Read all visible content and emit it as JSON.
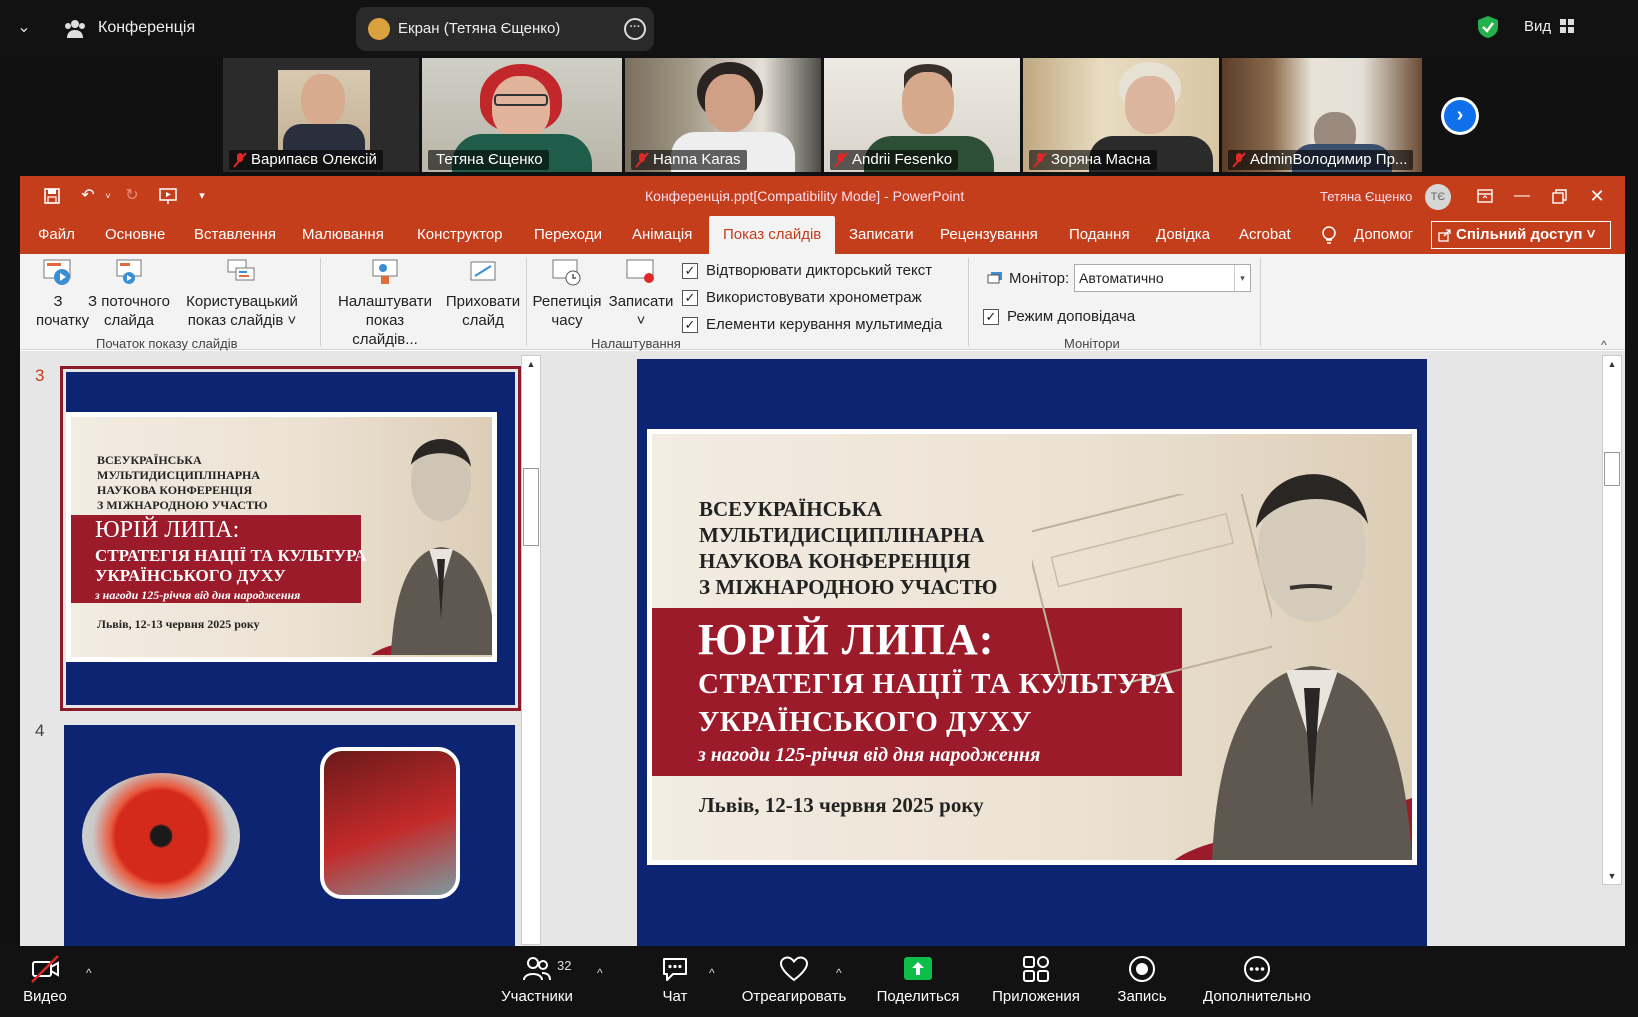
{
  "zoom_top": {
    "meeting_label": "Конференція",
    "screen_share_label": "Екран (Тетяна Єщенко)",
    "view_label": "Вид"
  },
  "participants": [
    {
      "name": "Варипаєв Олексій",
      "active": false,
      "muted": true
    },
    {
      "name": "Тетяна Єщенко",
      "active": true,
      "muted": false
    },
    {
      "name": "Hanna Karas",
      "active": false,
      "muted": true
    },
    {
      "name": "Andrii Fesenko",
      "active": false,
      "muted": true
    },
    {
      "name": "Зоряна Масна",
      "active": false,
      "muted": true
    },
    {
      "name": "AdminВолодимир Пр...",
      "active": false,
      "muted": true
    }
  ],
  "ppt": {
    "title": "Конференція.ppt[Compatibility Mode]  -  PowerPoint",
    "user": "Тетяна Єщенко",
    "user_initials": "ТЄ",
    "tabs": [
      "Файл",
      "Основне",
      "Вставлення",
      "Малювання",
      "Конструктор",
      "Переходи",
      "Анімація",
      "Показ слайдів",
      "Записати",
      "Рецензування",
      "Подання",
      "Довідка",
      "Acrobat"
    ],
    "selected_tab": "Показ слайдів",
    "help_label": "Допомог",
    "share_label": "Спільний доступ",
    "ribbon": {
      "btn_from_start": [
        "З",
        "початку"
      ],
      "btn_from_current": [
        "З поточного",
        "слайда"
      ],
      "btn_custom_show": [
        "Користувацький",
        "показ слайдів ˅"
      ],
      "group_start": "Початок показу слайдів",
      "btn_setup": [
        "Налаштувати",
        "показ слайдів..."
      ],
      "btn_hide": [
        "Приховати",
        "слайд"
      ],
      "btn_rehearse": [
        "Репетиція",
        "часу"
      ],
      "btn_record": [
        "Записати",
        "˅"
      ],
      "check_narration": "Відтворювати дикторський текст",
      "check_timings": "Використовувати хронометраж",
      "check_media": "Елементи керування мультимедіа",
      "group_setup": "Налаштування",
      "monitor_label": "Монітор:",
      "monitor_value": "Автоматично",
      "check_presenter": "Режим доповідача",
      "group_monitors": "Монітори"
    }
  },
  "slides": {
    "current_number": "3",
    "next_number": "4",
    "banner": {
      "line1": "ВСЕУКРАЇНСЬКА",
      "line2": "МУЛЬТИДИСЦИПЛІНАРНА",
      "line3": "НАУКОВА КОНФЕРЕНЦІЯ",
      "line4": "З МІЖНАРОДНОЮ УЧАСТЮ",
      "title": "ЮРІЙ ЛИПА:",
      "subtitle1": "СТРАТЕГІЯ НАЦІЇ ТА КУЛЬТУРА",
      "subtitle2": "УКРАЇНСЬКОГО ДУХУ",
      "occasion": "з нагоди 125-річчя від дня народження",
      "place_date": "Львів, 12-13 червня 2025 року"
    }
  },
  "zoom_bottom": {
    "video": "Видео",
    "participants": "Участники",
    "participants_count": "32",
    "chat": "Чат",
    "react": "Отреагировать",
    "share": "Поделиться",
    "apps": "Приложения",
    "record": "Запись",
    "more": "Дополнительно"
  },
  "colors": {
    "ppt_accent": "#c43e1c",
    "slide_blue": "#0c2471",
    "banner_red": "#9b1b2b",
    "zoom_share_green": "#0dbd49",
    "active_speaker": "#23d96b"
  }
}
